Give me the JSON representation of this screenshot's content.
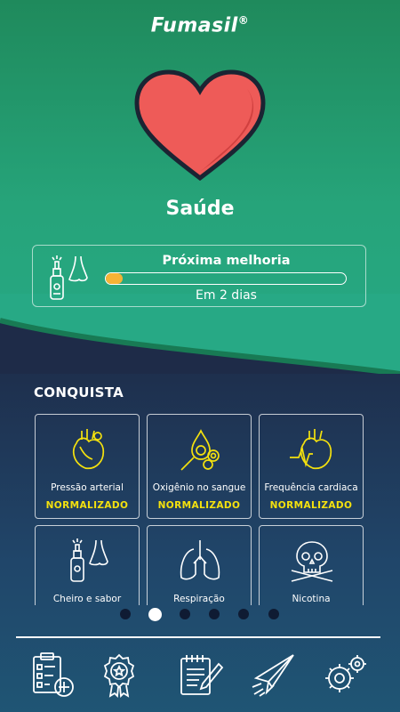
{
  "app": {
    "logo": "Fumasil",
    "logo_mark": "®"
  },
  "header": {
    "title": "Saúde"
  },
  "next_improvement": {
    "label": "Próxima melhoria",
    "subtitle": "Em 2 dias",
    "progress_fraction": 0.07,
    "icon": "nasal-spray-nose-icon"
  },
  "achievements": {
    "title": "CONQUISTA",
    "items": [
      {
        "label": "Pressão arterial",
        "status": "NORMALIZADO",
        "icon": "heart-organ-icon"
      },
      {
        "label": "Oxigênio no sangue",
        "status": "NORMALIZADO",
        "icon": "blood-oxygen-icon"
      },
      {
        "label": "Frequência cardiaca",
        "status": "NORMALIZADO",
        "icon": "heart-rate-icon"
      },
      {
        "label": "Cheiro e sabor",
        "status": "",
        "icon": "nasal-spray-nose-icon"
      },
      {
        "label": "Respiração",
        "status": "",
        "icon": "lungs-icon"
      },
      {
        "label": "Nicotina",
        "status": "",
        "icon": "skull-cigarettes-icon"
      }
    ]
  },
  "pagination": {
    "count": 6,
    "active": 1
  },
  "nav": [
    {
      "name": "health-checklist",
      "icon": "clipboard-plus-icon"
    },
    {
      "name": "achievements",
      "icon": "award-badge-icon"
    },
    {
      "name": "notes",
      "icon": "notepad-pencil-icon"
    },
    {
      "name": "share",
      "icon": "paper-plane-icon"
    },
    {
      "name": "settings",
      "icon": "gears-icon"
    }
  ],
  "colors": {
    "green_top": "#1f8a5c",
    "green_bottom": "#27a985",
    "navy": "#1e2b48",
    "heart": "#ee5b58",
    "accent_yellow": "#f4e10e",
    "progress_fill": "#f5b335"
  }
}
